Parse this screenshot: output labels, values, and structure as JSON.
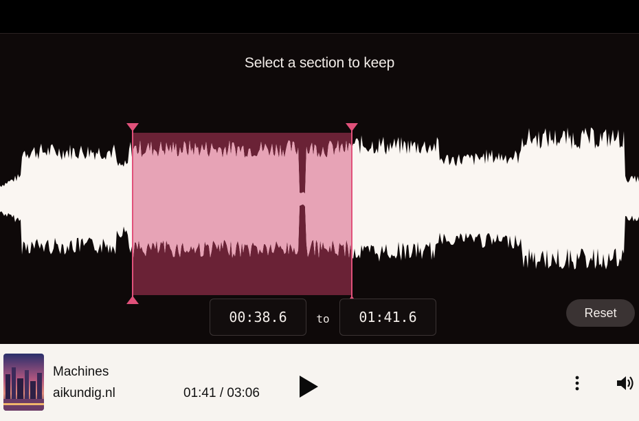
{
  "editor": {
    "instruction": "Select a section to keep",
    "selection_start": "00:38.6",
    "selection_end": "01:41.6",
    "to_label": "to",
    "reset_label": "Reset",
    "selection_start_fraction": 0.207,
    "selection_end_fraction": 0.55
  },
  "player": {
    "track_title": "Machines",
    "artist": "aikundig.nl",
    "time_display": "01:41 / 03:06",
    "icons": {
      "play": "play-icon",
      "more": "more-vertical-icon",
      "volume": "volume-icon",
      "cover": "album-cover"
    }
  },
  "colors": {
    "background": "#0e0909",
    "waveform": "#faf6f2",
    "selection_fill": "#6a2236",
    "selection_wave": "#e7a3b6",
    "handle": "#e0517a",
    "player_bg": "#f7f4f0"
  }
}
